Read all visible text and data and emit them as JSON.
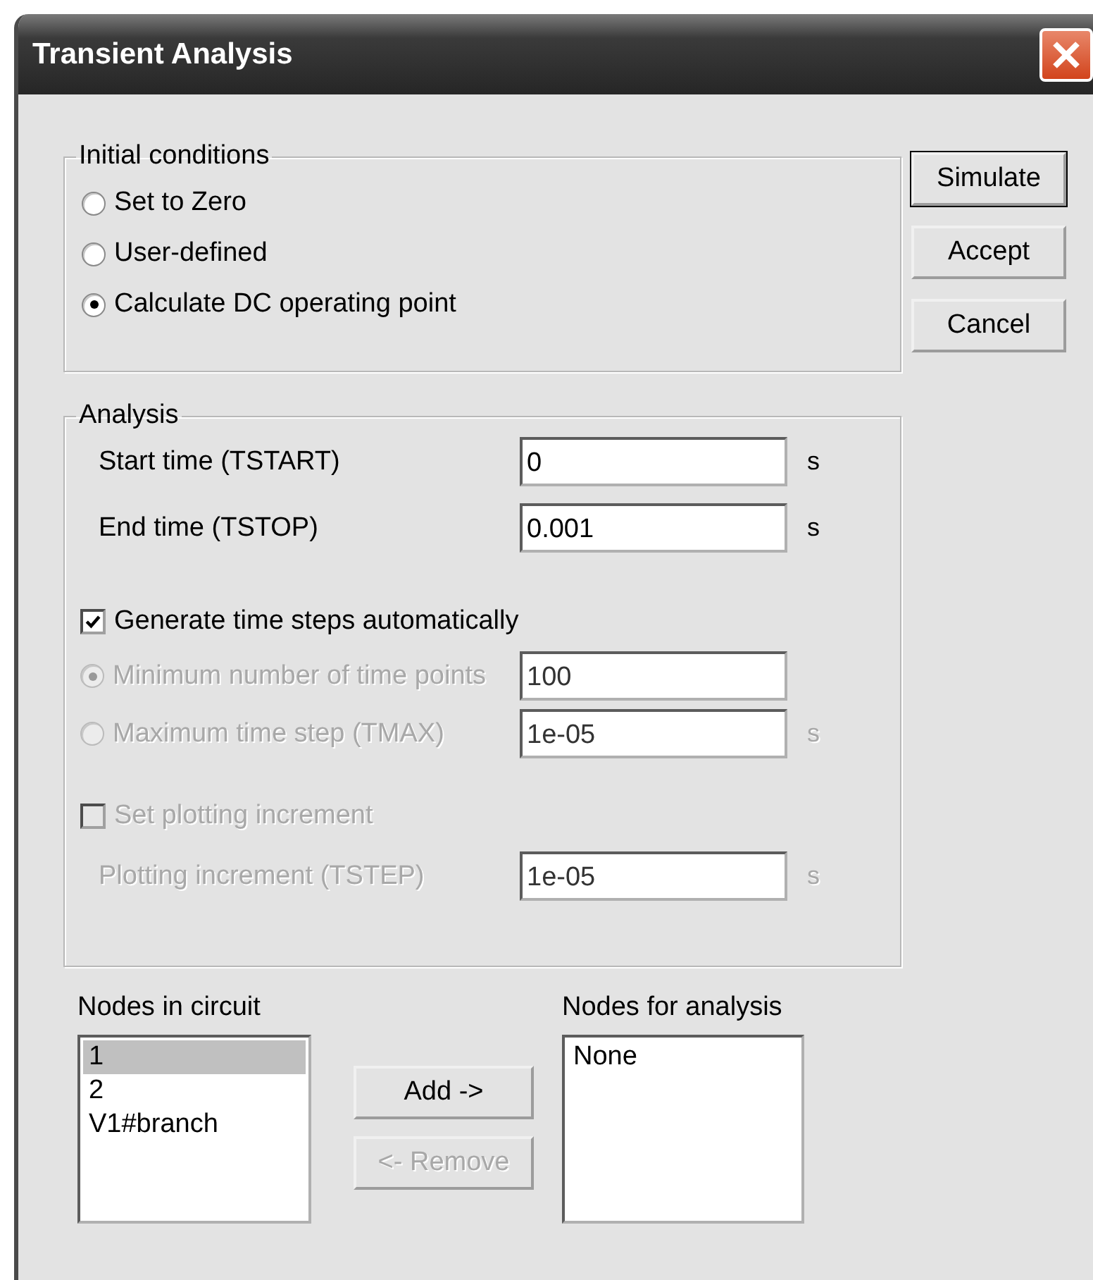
{
  "window": {
    "title": "Transient Analysis"
  },
  "initial_conditions": {
    "title": "Initial conditions",
    "options": [
      {
        "label": "Set to Zero",
        "selected": false
      },
      {
        "label": "User-defined",
        "selected": false
      },
      {
        "label": "Calculate DC operating point",
        "selected": true
      }
    ]
  },
  "buttons": [
    {
      "label": "Simulate",
      "default": true
    },
    {
      "label": "Accept",
      "default": false
    },
    {
      "label": "Cancel",
      "default": false
    }
  ],
  "analysis": {
    "title": "Analysis",
    "times": [
      {
        "label": "Start time (TSTART)",
        "value": "0",
        "unit": "s"
      },
      {
        "label": "End time (TSTOP)",
        "value": "0.001",
        "unit": "s"
      }
    ],
    "auto_steps": {
      "label": "Generate time steps automatically",
      "checked": true
    },
    "step_options": [
      {
        "label": "Minimum number of time points",
        "value": "100",
        "selected": true,
        "disabled": true
      },
      {
        "label": "Maximum time step (TMAX)",
        "value": "1e-05",
        "unit": "s",
        "selected": false,
        "disabled": true
      }
    ],
    "plot_increment": {
      "label": "Set plotting increment",
      "checked": false,
      "disabled": true
    },
    "tstep": {
      "label": "Plotting increment (TSTEP)",
      "value": "1e-05",
      "unit": "s",
      "disabled": true
    }
  },
  "nodes_in_circuit": {
    "label": "Nodes in circuit",
    "items": [
      {
        "text": "1",
        "selected": true
      },
      {
        "text": "2",
        "selected": false
      },
      {
        "text": "V1#branch",
        "selected": false
      }
    ]
  },
  "add_button": {
    "label": "Add ->",
    "disabled": false
  },
  "remove_button": {
    "label": "<- Remove",
    "disabled": true
  },
  "nodes_for_analysis": {
    "label": "Nodes for analysis",
    "items": [
      {
        "text": "None",
        "selected": false
      }
    ]
  }
}
